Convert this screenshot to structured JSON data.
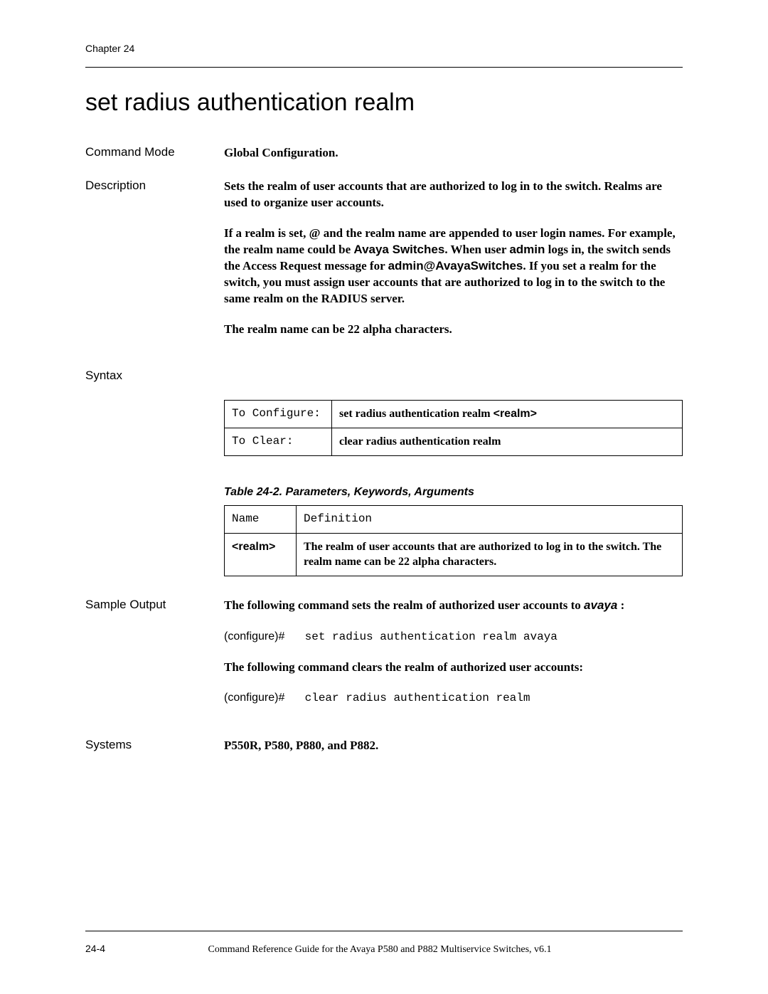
{
  "header": {
    "chapter": "Chapter 24"
  },
  "title": "set radius authentication realm",
  "command_mode": {
    "label": "Command Mode",
    "value": "Global Configuration."
  },
  "description": {
    "label": "Description",
    "p1": "Sets the realm of user accounts that are authorized to log in to the switch. Realms are used to organize user accounts.",
    "p2_a": "If a realm is set, ",
    "p2_at": "@",
    "p2_b": " and the realm name are appended to user login names. For example, the realm name could be ",
    "p2_realm": "Avaya Switches",
    "p2_c": ". When user ",
    "p2_user": "admin",
    "p2_d": " logs in, the switch sends the Access Request message for ",
    "p2_full": "admin@AvayaSwitches",
    "p2_e": ". If you set a realm for the switch, you must assign user accounts that are authorized to log in to the switch to the same realm on the RADIUS server.",
    "p3": "The realm name can be 22 alpha characters."
  },
  "syntax": {
    "label": "Syntax",
    "rows": [
      {
        "left": "To Configure:",
        "right_a": "set radius authentication realm ",
        "right_b": "<realm>"
      },
      {
        "left": "To Clear:",
        "right_a": "clear radius authentication realm",
        "right_b": ""
      }
    ]
  },
  "param_table": {
    "caption": "Table 24-2.  Parameters, Keywords, Arguments",
    "headers": {
      "name": "Name",
      "definition": "Definition"
    },
    "row": {
      "name": "<realm>",
      "def": "The realm of user accounts that are authorized to log in to the switch. The realm name can be 22 alpha characters."
    }
  },
  "sample": {
    "label": "Sample Output",
    "intro1_a": "The following command sets the realm of authorized user accounts to ",
    "intro1_b": "avaya",
    "intro1_c": " :",
    "prompt": "(configure)#",
    "cmd1": "set radius authentication realm avaya",
    "intro2": "The following command clears the realm of authorized user accounts:",
    "cmd2": "clear radius authentication realm"
  },
  "systems": {
    "label": "Systems",
    "value": "P550R, P580, P880, and P882."
  },
  "footer": {
    "page": "24-4",
    "text": "Command Reference Guide for the Avaya P580 and P882 Multiservice Switches, v6.1"
  }
}
